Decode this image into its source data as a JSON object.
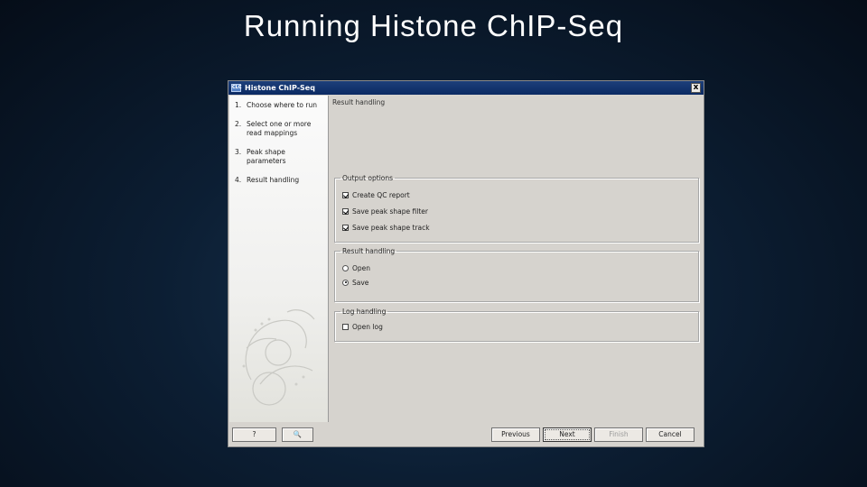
{
  "slide": {
    "title": "Running Histone ChIP-Seq"
  },
  "dialog": {
    "title": "Histone ChIP-Seq",
    "app_icon_text": "CLC",
    "close_label": "x",
    "steps": [
      {
        "num": "1.",
        "label": "Choose where to run"
      },
      {
        "num": "2.",
        "label": "Select one or more read mappings"
      },
      {
        "num": "3.",
        "label": "Peak shape parameters"
      },
      {
        "num": "4.",
        "label": "Result handling"
      }
    ],
    "section_title": "Result handling",
    "output_options": {
      "legend": "Output options",
      "items": [
        {
          "label": "Create QC report",
          "checked": true
        },
        {
          "label": "Save peak shape filter",
          "checked": true
        },
        {
          "label": "Save peak shape track",
          "checked": true
        }
      ]
    },
    "result_handling": {
      "legend": "Result handling",
      "options": [
        {
          "label": "Open",
          "selected": false
        },
        {
          "label": "Save",
          "selected": true
        }
      ]
    },
    "log_handling": {
      "legend": "Log handling",
      "items": [
        {
          "label": "Open log",
          "checked": false
        }
      ]
    },
    "buttons": {
      "help": "?",
      "preview": "🔍",
      "previous": "Previous",
      "next": "Next",
      "finish": "Finish",
      "cancel": "Cancel"
    }
  }
}
